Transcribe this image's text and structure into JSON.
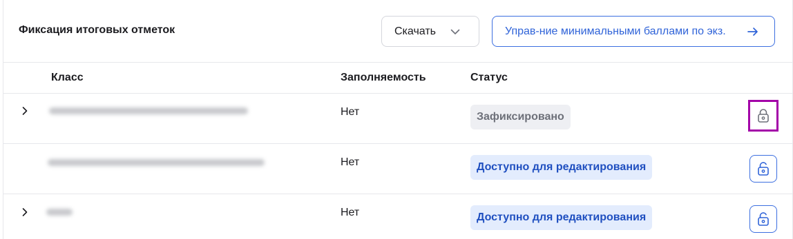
{
  "header": {
    "title": "Фиксация итоговых отметок",
    "download_label": "Скачать",
    "manage_label": "Управ-ние минимальными баллами по экз."
  },
  "table": {
    "columns": [
      "Класс",
      "Заполняемость",
      "Статус"
    ],
    "rows": [
      {
        "fill": "Нет",
        "status": "Зафиксировано",
        "status_kind": "fixed",
        "lock": "locked",
        "expandable": true
      },
      {
        "fill": "Нет",
        "status": "Доступно для редактирования",
        "status_kind": "editable",
        "lock": "unlocked",
        "expandable": false
      },
      {
        "fill": "Нет",
        "status": "Доступно для редактирования",
        "status_kind": "editable",
        "lock": "unlocked",
        "expandable": true
      }
    ]
  },
  "colors": {
    "accent": "#3b6ee0",
    "highlight": "#a300a8",
    "badge_fixed_bg": "#eeeff3",
    "badge_editable_bg": "#e3ecfd"
  },
  "icons": {
    "download_chevron": "chevron-down-icon",
    "manage_arrow": "arrow-right-icon",
    "expand": "chevron-right-icon",
    "locked": "lock-icon",
    "unlocked": "unlock-icon"
  }
}
